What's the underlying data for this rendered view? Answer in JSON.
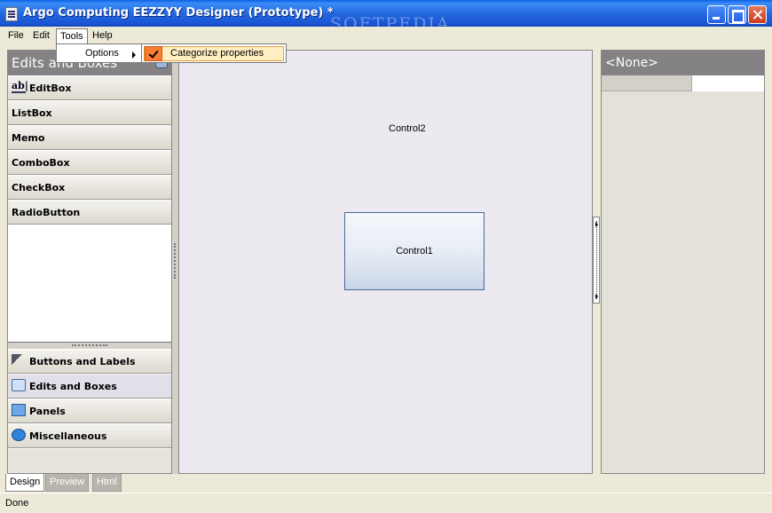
{
  "window": {
    "title": "Argo Computing EEZZYY Designer (Prototype) *",
    "watermark": "SOFTPEDIA"
  },
  "menubar": {
    "items": [
      {
        "label": "File"
      },
      {
        "label": "Edit"
      },
      {
        "label": "Tools"
      },
      {
        "label": "Help"
      }
    ]
  },
  "tools_menu": {
    "options_label": "Options",
    "submenu": {
      "label": "Categorize properties",
      "checked": true
    }
  },
  "toolbox": {
    "header": "Edits and Boxes",
    "items": [
      {
        "label": "EditBox",
        "icon": "editbox-icon"
      },
      {
        "label": "ListBox"
      },
      {
        "label": "Memo"
      },
      {
        "label": "ComboBox"
      },
      {
        "label": "CheckBox"
      },
      {
        "label": "RadioButton"
      }
    ],
    "categories": [
      {
        "label": "Buttons and Labels",
        "icon": "buttons-labels-icon"
      },
      {
        "label": "Edits and Boxes",
        "icon": "edits-boxes-icon",
        "selected": true
      },
      {
        "label": "Panels",
        "icon": "panels-icon"
      },
      {
        "label": "Miscellaneous",
        "icon": "miscellaneous-icon"
      }
    ]
  },
  "canvas": {
    "control1": "Control1",
    "control2": "Control2"
  },
  "properties": {
    "header": "<None>"
  },
  "tabs": [
    {
      "label": "Design",
      "active": true
    },
    {
      "label": "Preview"
    },
    {
      "label": "Html"
    }
  ],
  "status": {
    "text": "Done"
  },
  "colors": {
    "titlebar": "#2468E0",
    "panel_header": "#848284",
    "highlight": "#FFEEC2",
    "check": "#FC7D30"
  }
}
